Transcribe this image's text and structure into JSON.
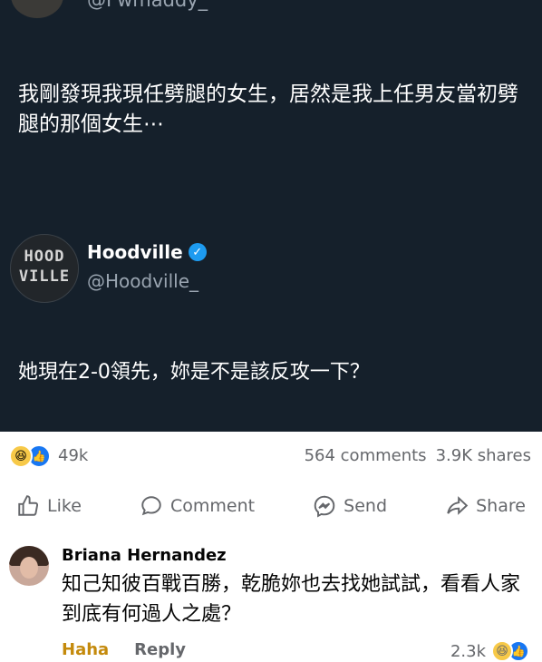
{
  "tweet_top": {
    "handle": "@Fwmaddy_",
    "text": "我剛發現我現任劈腿的女生，居然是我上任男友當初劈腿的那個女生⋯"
  },
  "tweet_reply": {
    "avatar_logo_line1": "HOOD",
    "avatar_logo_line2": "VILLE",
    "name": "Hoodville",
    "handle": "@Hoodville_",
    "text": "她現在2-0領先，妳是不是該反攻一下？"
  },
  "post": {
    "reaction_count": "49k",
    "comments": "564 comments",
    "shares": "3.9K shares",
    "actions": {
      "like": "Like",
      "comment": "Comment",
      "send": "Send",
      "share": "Share"
    }
  },
  "comment": {
    "author": "Briana Hernandez",
    "text": "知己知彼百戰百勝，乾脆妳也去找她試試，看看人家到底有何過人之處？",
    "haha": "Haha",
    "reply": "Reply",
    "count": "2.3k"
  },
  "colors": {
    "dark_bg": "#15202b",
    "verified": "#1d9bf0",
    "like_blue": "#1877f2",
    "haha_yellow": "#f7c948",
    "muted": "#65676b"
  }
}
